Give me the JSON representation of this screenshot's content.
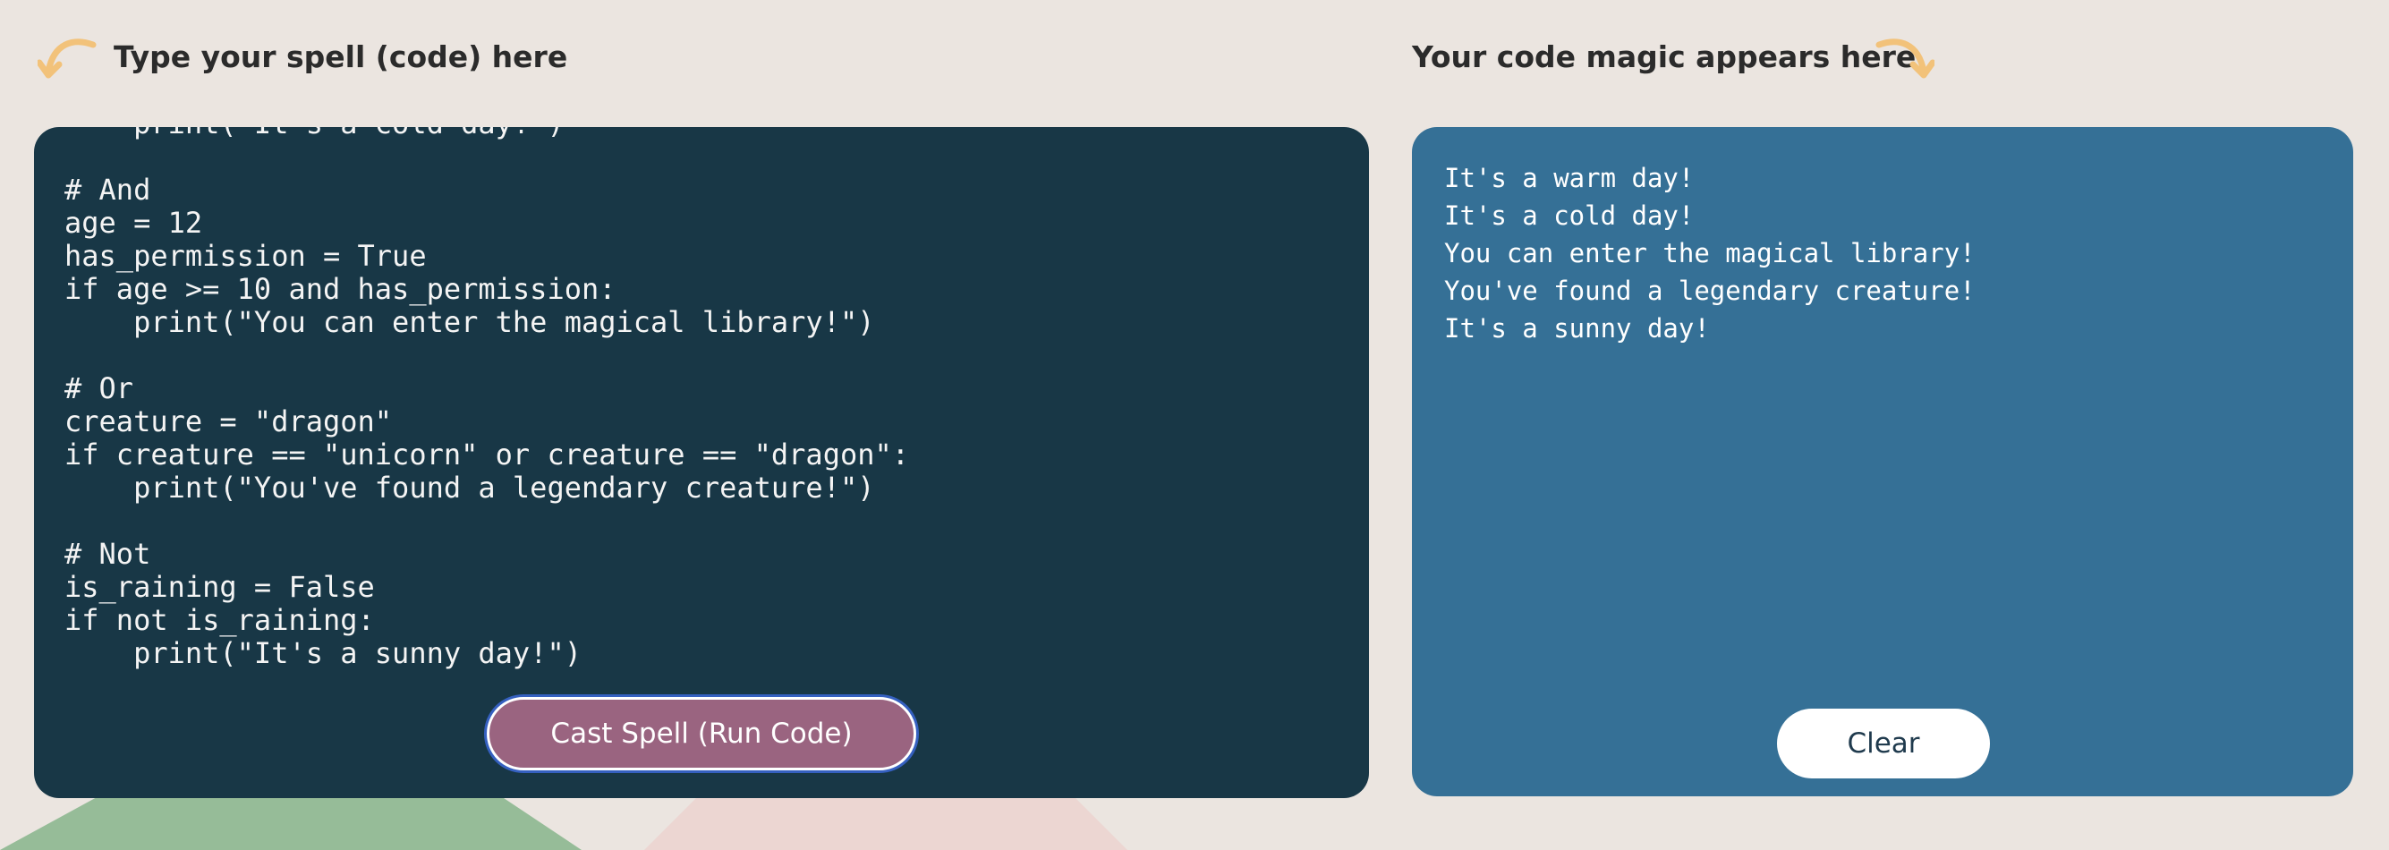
{
  "editor": {
    "title": "Type your spell (code) here",
    "code": "    print(\"It's a cold day!\")\n\n# And\nage = 12\nhas_permission = True\nif age >= 10 and has_permission:\n    print(\"You can enter the magical library!\")\n\n# Or\ncreature = \"dragon\"\nif creature == \"unicorn\" or creature == \"dragon\":\n    print(\"You've found a legendary creature!\")\n\n# Not\nis_raining = False\nif not is_raining:\n    print(\"It's a sunny day!\")",
    "run_label": "Cast Spell (Run Code)",
    "arrow_icon": "curved-arrow-left-icon"
  },
  "output": {
    "title": "Your code magic appears here",
    "lines": [
      "It's a warm day!",
      "It's a cold day!",
      "You can enter the magical library!",
      "You've found a legendary creature!",
      "It's a sunny day!"
    ],
    "clear_label": "Clear",
    "arrow_icon": "curved-arrow-right-icon"
  },
  "colors": {
    "page_bg": "#ebe5e0",
    "editor_bg": "#183746",
    "output_bg": "#357096",
    "run_button": "#9a6480",
    "arrow": "#f2c27a"
  }
}
